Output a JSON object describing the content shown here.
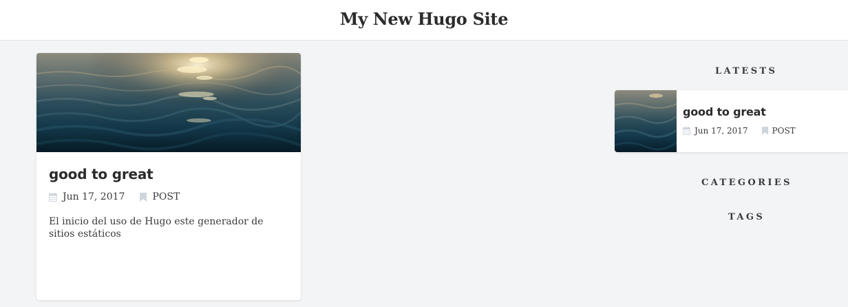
{
  "site": {
    "title": "My New Hugo Site"
  },
  "post": {
    "title": "good to great",
    "date": "Jun 17, 2017",
    "category": "POST",
    "excerpt": "El inicio del uso de Hugo este generador de sitios estáticos",
    "image": "ocean-waves-image"
  },
  "sidebar": {
    "latests_heading": "LATESTS",
    "categories_heading": "CATEGORIES",
    "tags_heading": "TAGS",
    "latest_items": [
      {
        "title": "good to great",
        "date": "Jun 17, 2017",
        "category": "POST",
        "image": "ocean-waves-thumbnail"
      }
    ]
  },
  "icons": {
    "date": "calendar-icon",
    "category": "bookmark-icon"
  },
  "colors": {
    "page_background": "#f3f4f6",
    "card_background": "#ffffff",
    "text": "#2b2b2b",
    "icon": "#cfd5dc",
    "water_dark": "#0b2a3a",
    "water_light": "#f2d6a0"
  }
}
